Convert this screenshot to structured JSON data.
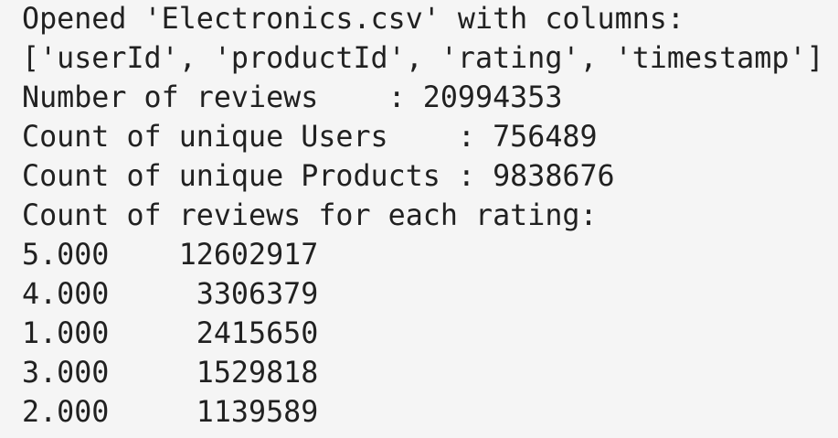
{
  "output": {
    "lines": [
      "Opened 'Electronics.csv' with columns:",
      "['userId', 'productId', 'rating', 'timestamp']",
      "Number of reviews    : 20994353",
      "Count of unique Users    : 756489",
      "Count of unique Products : 9838676",
      "Count of reviews for each rating:",
      "5.000    12602917",
      "4.000     3306379",
      "1.000     2415650",
      "3.000     1529818",
      "2.000     1139589"
    ]
  },
  "colors": {
    "background": "#f5f5f5",
    "text": "#212121"
  }
}
